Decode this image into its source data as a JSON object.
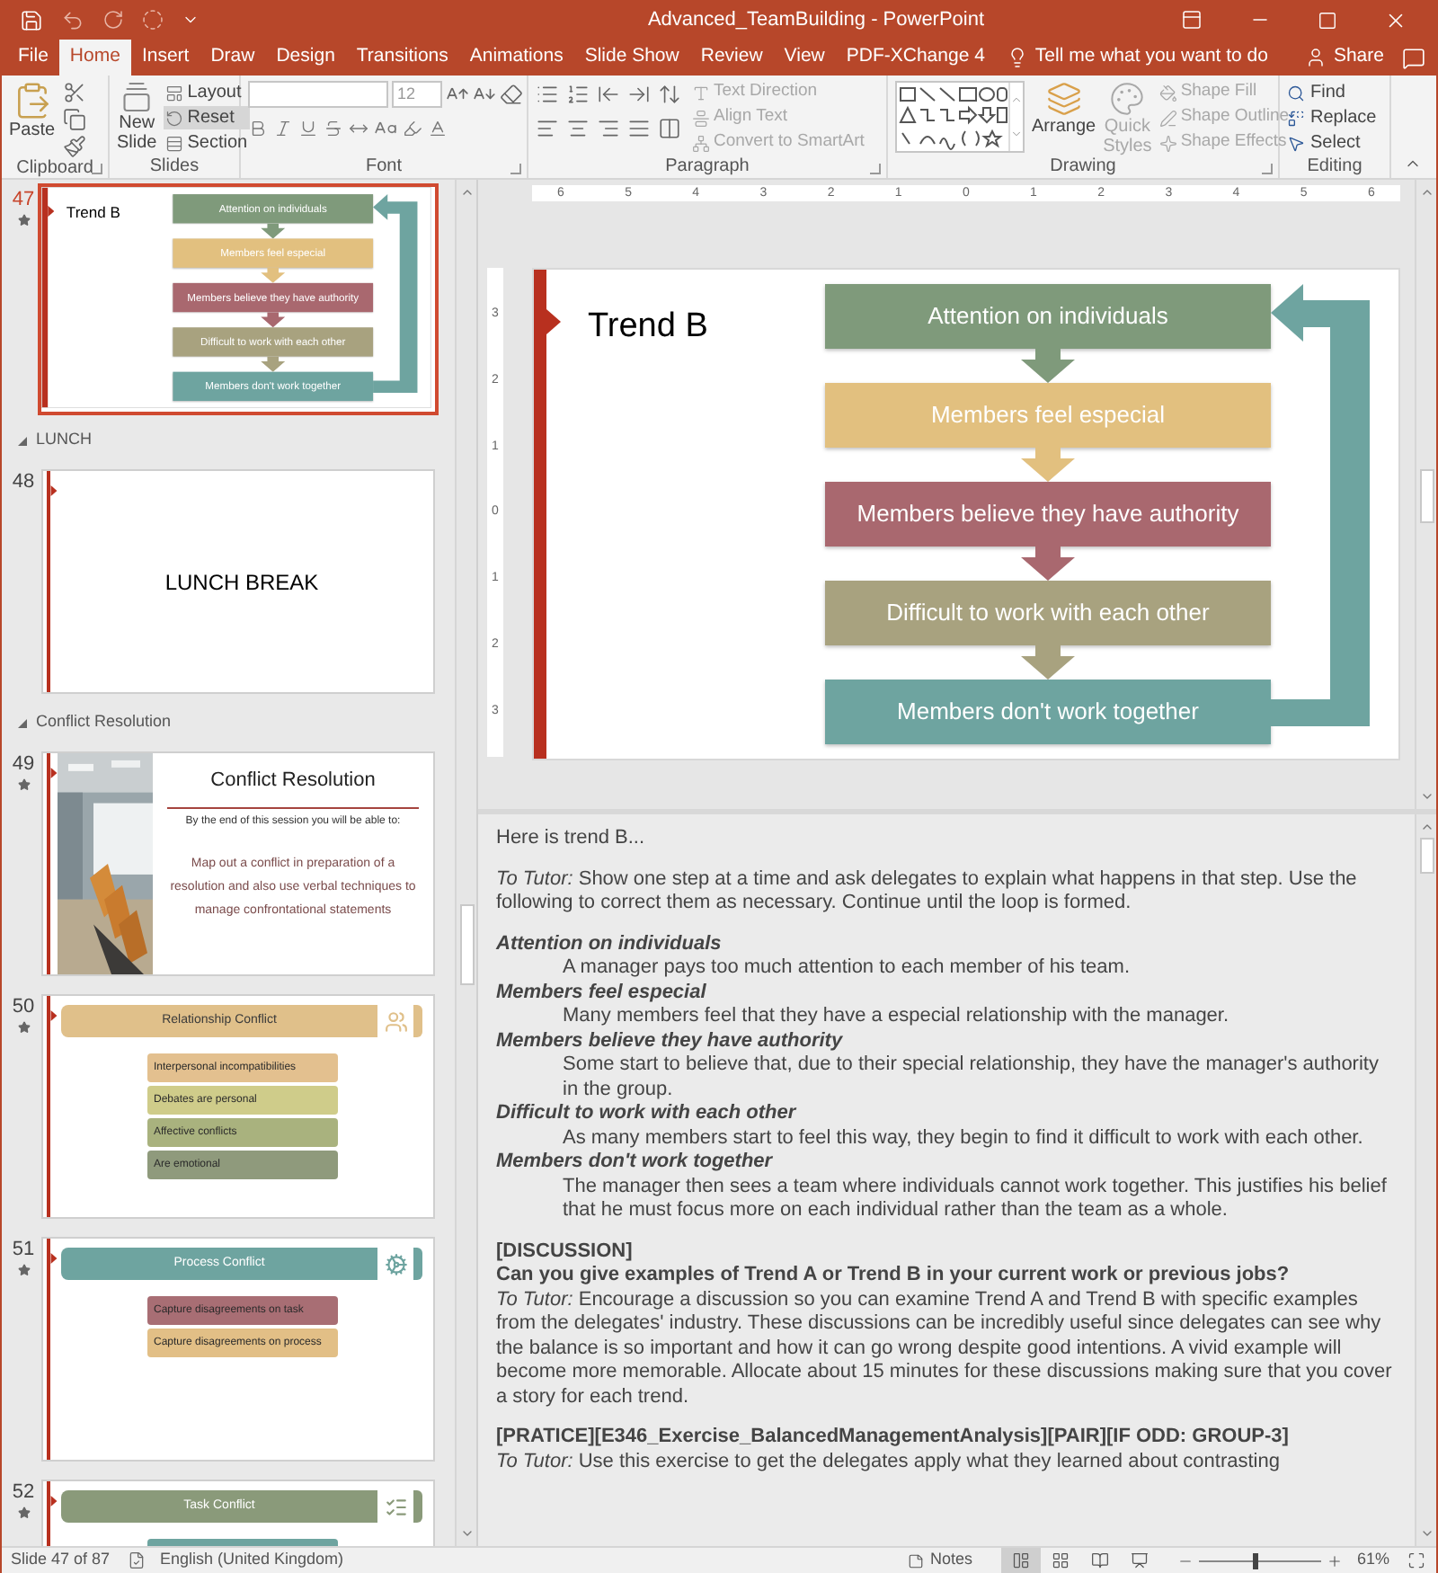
{
  "window": {
    "title": "Advanced_TeamBuilding - PowerPoint"
  },
  "tabs": [
    {
      "label": "File",
      "selected": false
    },
    {
      "label": "Home",
      "selected": true
    },
    {
      "label": "Insert",
      "selected": false
    },
    {
      "label": "Draw",
      "selected": false
    },
    {
      "label": "Design",
      "selected": false
    },
    {
      "label": "Transitions",
      "selected": false
    },
    {
      "label": "Animations",
      "selected": false
    },
    {
      "label": "Slide Show",
      "selected": false
    },
    {
      "label": "Review",
      "selected": false
    },
    {
      "label": "View",
      "selected": false
    },
    {
      "label": "PDF-XChange 4",
      "selected": false
    }
  ],
  "tell_me": {
    "placeholder": "Tell me what you want to do"
  },
  "share": "Share",
  "ribbon": {
    "clipboard": {
      "name": "Clipboard",
      "paste": "Paste"
    },
    "slides": {
      "name": "Slides",
      "new_slide": "New Slide",
      "buttons": [
        {
          "label": "Layout",
          "selected": false
        },
        {
          "label": "Reset",
          "selected": true
        },
        {
          "label": "Section",
          "selected": false
        }
      ]
    },
    "font": {
      "name": "Font",
      "font_size": "12"
    },
    "paragraph": {
      "name": "Paragraph",
      "buttons": [
        {
          "label": "Text Direction",
          "disabled": true
        },
        {
          "label": "Align Text",
          "disabled": true
        },
        {
          "label": "Convert to SmartArt",
          "disabled": true
        }
      ]
    },
    "drawing": {
      "name": "Drawing",
      "arrange": "Arrange",
      "quick_styles": {
        "label": "Quick Styles",
        "disabled": true
      },
      "buttons": [
        {
          "label": "Shape Fill",
          "disabled": true
        },
        {
          "label": "Shape Outline",
          "disabled": true
        },
        {
          "label": "Shape Effects",
          "disabled": true
        }
      ]
    },
    "editing": {
      "name": "Editing",
      "buttons": [
        {
          "label": "Find"
        },
        {
          "label": "Replace"
        },
        {
          "label": "Select"
        }
      ]
    }
  },
  "thumbnails": [
    {
      "kind": "flow",
      "number": "47",
      "selected": true,
      "animated": true,
      "title": "Trend B",
      "steps": [
        {
          "label": "Attention on individuals",
          "color": "#7f9a7b"
        },
        {
          "label": "Members feel especial",
          "color": "#e2c07f"
        },
        {
          "label": "Members believe they have authority",
          "color": "#a9686f"
        },
        {
          "label": "Difficult to work with each other",
          "color": "#a8a27f"
        },
        {
          "label": "Members don't work together",
          "color": "#6ea4a0"
        }
      ]
    },
    {
      "kind": "section",
      "label": "LUNCH",
      "expanded": true
    },
    {
      "kind": "title",
      "number": "48",
      "selected": false,
      "animated": false,
      "title": "LUNCH BREAK"
    },
    {
      "kind": "section",
      "label": "Conflict Resolution",
      "expanded": true
    },
    {
      "kind": "session",
      "number": "49",
      "selected": false,
      "animated": true,
      "title": "Conflict Resolution",
      "intro": "By the end of this session you will be able to:",
      "body": "Map out a conflict in preparation of a resolution and also use verbal techniques to manage confrontational statements"
    },
    {
      "kind": "list",
      "number": "50",
      "selected": false,
      "animated": true,
      "header": "Relationship Conflict",
      "color": "#e0c08a",
      "items": [
        {
          "label": "Interpersonal incompatibilities",
          "color": "#e3c08f"
        },
        {
          "label": "Debates are personal",
          "color": "#cfcc8a"
        },
        {
          "label": "Affective conflicts",
          "color": "#a9b27e"
        },
        {
          "label": "Are emotional",
          "color": "#8f9a7c"
        }
      ]
    },
    {
      "kind": "list",
      "number": "51",
      "selected": false,
      "animated": true,
      "header": "Process Conflict",
      "color": "#6ea4a0",
      "items": [
        {
          "label": "Capture disagreements on task",
          "color": "#a86e74"
        },
        {
          "label": "Capture disagreements on process",
          "color": "#e2bf86"
        }
      ]
    },
    {
      "kind": "list",
      "number": "52",
      "selected": false,
      "animated": true,
      "header": "Task Conflict",
      "color": "#8a9a7a",
      "items": [
        {
          "color": "#6ea4a0"
        }
      ]
    }
  ],
  "rulers": {
    "horizontal": [
      "6",
      "5",
      "4",
      "3",
      "2",
      "1",
      "0",
      "1",
      "2",
      "3",
      "4",
      "5",
      "6"
    ],
    "vertical": [
      "3",
      "2",
      "1",
      "0",
      "1",
      "2",
      "3"
    ]
  },
  "slide": {
    "title": "Trend B",
    "steps": [
      {
        "label": "Attention on individuals",
        "color": "#7f9a7b"
      },
      {
        "label": "Members feel especial",
        "color": "#e2c07f"
      },
      {
        "label": "Members believe they have authority",
        "color": "#a9686f"
      },
      {
        "label": "Difficult to work with each other",
        "color": "#a8a27f"
      },
      {
        "label": "Members don't work together",
        "color": "#6ea4a0"
      }
    ]
  },
  "notes": [
    {
      "kind": "para",
      "lines": [
        {
          "text": "Here is trend B...",
          "bold": false
        }
      ]
    },
    {
      "kind": "para",
      "lines": [
        {
          "text": "*To Tutor:* Show one step at a time and ask delegates to explain what happens in that step. Use the following to correct them as necessary. Continue until the loop is formed.",
          "bold": false
        }
      ]
    },
    {
      "kind": "terms",
      "entries": [
        {
          "term": "Attention on individuals",
          "text": "A manager pays too much attention to each member of his team."
        },
        {
          "term": "Members feel especial",
          "text": "Many members feel that they have a especial relationship with the manager."
        },
        {
          "term": "Members believe they have authority",
          "text": "Some start to believe that, due to their special relationship, they have the manager's authority in the group."
        },
        {
          "term": "Difficult to work with each other",
          "text": "As many members start to feel this way, they begin to find it difficult to work with each other."
        },
        {
          "term": "Members don't work together",
          "text": "The manager then sees a team where individuals cannot work together. This justifies his belief that he must focus more on each individual rather than the team as a whole."
        }
      ]
    },
    {
      "kind": "para",
      "lines": [
        {
          "text": "[DISCUSSION]",
          "bold": true
        },
        {
          "text": "Can you give examples of Trend A or Trend B in your current work or previous jobs?",
          "bold": true
        },
        {
          "text": "*To Tutor:* Encourage a discussion so you can examine Trend A and Trend B with specific examples from the delegates' industry. These discussions can be incredibly useful since delegates can see why the balance is so important and how it can go wrong despite good intentions. A vivid example will become more memorable. Allocate about 15 minutes for these discussions making sure that you cover a story for each trend.",
          "bold": false
        }
      ]
    },
    {
      "kind": "para",
      "lines": [
        {
          "text": "[PRATICE][E346_Exercise_BalancedManagementAnalysis][PAIR][IF ODD: GROUP-3]",
          "bold": true
        },
        {
          "text": "*To Tutor:* Use this exercise to get the delegates apply what they learned about contrasting",
          "bold": false
        }
      ]
    }
  ],
  "status": {
    "slide_info": "Slide 47 of 87",
    "language": "English (United Kingdom)",
    "notes": "Notes",
    "views": [
      {
        "kind": "normal",
        "selected": true
      },
      {
        "kind": "sorter",
        "selected": false
      },
      {
        "kind": "reading",
        "selected": false
      },
      {
        "kind": "slideshow",
        "selected": false
      }
    ],
    "zoom": {
      "level": 0.45,
      "reading": "61%"
    }
  }
}
